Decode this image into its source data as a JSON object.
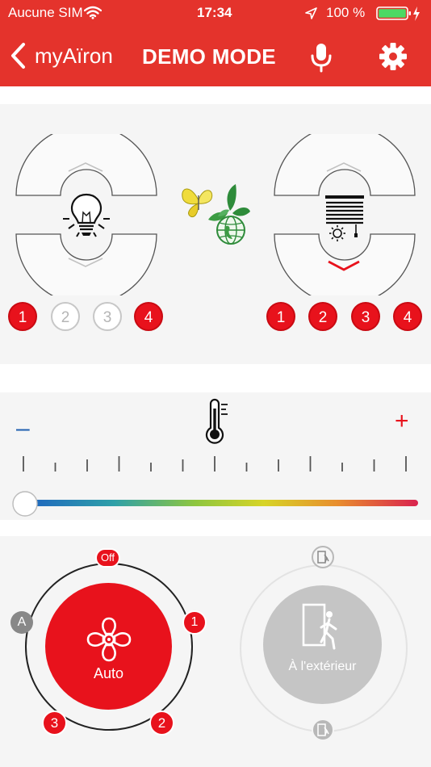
{
  "status_bar": {
    "carrier": "Aucune SIM",
    "time": "17:34",
    "battery": "100 %"
  },
  "nav": {
    "back_label": "myAïron",
    "title": "DEMO MODE"
  },
  "lighting": {
    "channels": [
      {
        "label": "1",
        "active": true
      },
      {
        "label": "2",
        "active": false
      },
      {
        "label": "3",
        "active": false
      },
      {
        "label": "4",
        "active": true
      }
    ]
  },
  "blinds": {
    "channels": [
      {
        "label": "1",
        "active": true
      },
      {
        "label": "2",
        "active": true
      },
      {
        "label": "3",
        "active": true
      },
      {
        "label": "4",
        "active": true
      }
    ]
  },
  "temperature": {
    "minus": "–",
    "plus": "+",
    "level": 0.0
  },
  "ventilation": {
    "off_label": "Off",
    "auto_letter": "A",
    "speed_1": "1",
    "speed_2": "2",
    "speed_3": "3",
    "mode_label": "Auto"
  },
  "away": {
    "label": "À l'extérieur"
  },
  "colors": {
    "accent": "#e4332c",
    "active": "#e8121c",
    "inactive": "#c7c7c7"
  }
}
